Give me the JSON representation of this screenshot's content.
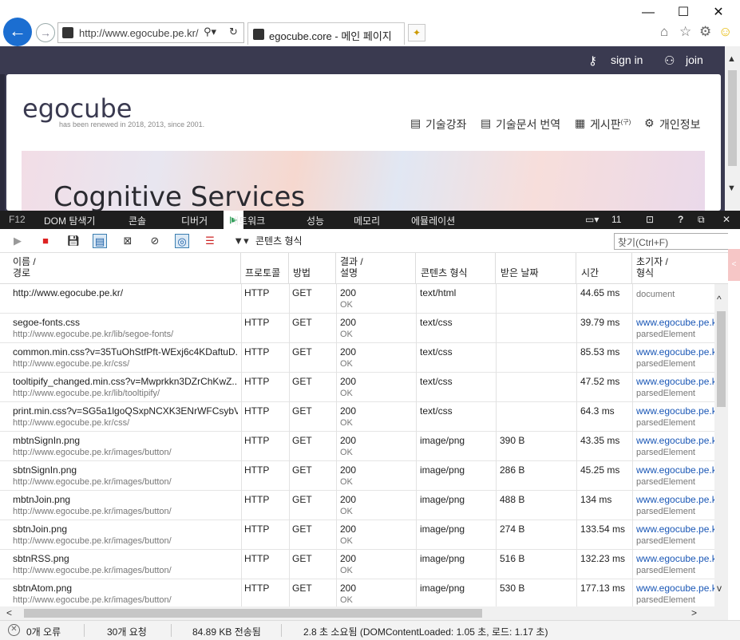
{
  "browser": {
    "window": {
      "min": "—",
      "max": "☐",
      "close": "✕"
    },
    "address": {
      "url": "http://www.egocube.pe.kr/",
      "search_icon": "⚲▾",
      "refresh_icon": "↻"
    },
    "tab": {
      "title": "egocube.core - 메인 페이지",
      "close": "✕"
    },
    "icons": {
      "home": "⌂",
      "favorites": "☆",
      "settings": "⚙",
      "smiley": "☺"
    }
  },
  "site": {
    "signin": "sign in",
    "join": "join",
    "logo": "egocube",
    "tagline": "has been renewed in 2018, 2013, since 2001.",
    "menu": [
      "기술강좌",
      "기술문서 번역",
      "게시판",
      "개인정보"
    ],
    "menu_icons": [
      "document-icon",
      "document-icon",
      "board-icon",
      "gear-icon"
    ],
    "board_sup": "(구)",
    "banner_text": "Cognitive Services"
  },
  "devtools": {
    "tabs": [
      "F12",
      "DOM 탐색기",
      "콘솔",
      "디버거",
      "네트워크",
      "성능",
      "메모리",
      "에뮬레이션"
    ],
    "active_tab": "네트워크",
    "emulation_count": "11",
    "toolbar": {
      "filter_label": "콘텐츠 형식",
      "find_placeholder": "찾기(Ctrl+F)"
    },
    "columns": [
      {
        "l1": "이름 /",
        "l2": "경로"
      },
      {
        "l1": "프로토콜",
        "l2": ""
      },
      {
        "l1": "방법",
        "l2": ""
      },
      {
        "l1": "결과 /",
        "l2": "설명"
      },
      {
        "l1": "콘텐츠 형식",
        "l2": ""
      },
      {
        "l1": "받은 날짜",
        "l2": ""
      },
      {
        "l1": "시간",
        "l2": ""
      },
      {
        "l1": "초기자 /",
        "l2": "형식"
      }
    ],
    "rows": [
      {
        "name": "http://www.egocube.pe.kr/",
        "path": "",
        "protocol": "HTTP",
        "method": "GET",
        "result": "200",
        "desc": "OK",
        "type": "text/html",
        "received": "",
        "time": "44.65 ms",
        "initiator": "",
        "init_type": "document"
      },
      {
        "name": "segoe-fonts.css",
        "path": "http://www.egocube.pe.kr/lib/segoe-fonts/",
        "protocol": "HTTP",
        "method": "GET",
        "result": "200",
        "desc": "OK",
        "type": "text/css",
        "received": "",
        "time": "39.79 ms",
        "initiator": "www.egocube.pe.k",
        "init_type": "parsedElement"
      },
      {
        "name": "common.min.css?v=35TuOhStfPft-WExj6c4KDaftuD...",
        "path": "http://www.egocube.pe.kr/css/",
        "protocol": "HTTP",
        "method": "GET",
        "result": "200",
        "desc": "OK",
        "type": "text/css",
        "received": "",
        "time": "85.53 ms",
        "initiator": "www.egocube.pe.k",
        "init_type": "parsedElement"
      },
      {
        "name": "tooltipify_changed.min.css?v=Mwprkkn3DZrChKwZ...",
        "path": "http://www.egocube.pe.kr/lib/tooltipify/",
        "protocol": "HTTP",
        "method": "GET",
        "result": "200",
        "desc": "OK",
        "type": "text/css",
        "received": "",
        "time": "47.52 ms",
        "initiator": "www.egocube.pe.k",
        "init_type": "parsedElement"
      },
      {
        "name": "print.min.css?v=SG5a1lgoQSxpNCXK3ENrWFCsybV...",
        "path": "http://www.egocube.pe.kr/css/",
        "protocol": "HTTP",
        "method": "GET",
        "result": "200",
        "desc": "OK",
        "type": "text/css",
        "received": "",
        "time": "64.3 ms",
        "initiator": "www.egocube.pe.k",
        "init_type": "parsedElement"
      },
      {
        "name": "mbtnSignIn.png",
        "path": "http://www.egocube.pe.kr/images/button/",
        "protocol": "HTTP",
        "method": "GET",
        "result": "200",
        "desc": "OK",
        "type": "image/png",
        "received": "390 B",
        "time": "43.35 ms",
        "initiator": "www.egocube.pe.k",
        "init_type": "parsedElement"
      },
      {
        "name": "sbtnSignIn.png",
        "path": "http://www.egocube.pe.kr/images/button/",
        "protocol": "HTTP",
        "method": "GET",
        "result": "200",
        "desc": "OK",
        "type": "image/png",
        "received": "286 B",
        "time": "45.25 ms",
        "initiator": "www.egocube.pe.k",
        "init_type": "parsedElement"
      },
      {
        "name": "mbtnJoin.png",
        "path": "http://www.egocube.pe.kr/images/button/",
        "protocol": "HTTP",
        "method": "GET",
        "result": "200",
        "desc": "OK",
        "type": "image/png",
        "received": "488 B",
        "time": "134 ms",
        "initiator": "www.egocube.pe.k",
        "init_type": "parsedElement"
      },
      {
        "name": "sbtnJoin.png",
        "path": "http://www.egocube.pe.kr/images/button/",
        "protocol": "HTTP",
        "method": "GET",
        "result": "200",
        "desc": "OK",
        "type": "image/png",
        "received": "274 B",
        "time": "133.54 ms",
        "initiator": "www.egocube.pe.k",
        "init_type": "parsedElement"
      },
      {
        "name": "sbtnRSS.png",
        "path": "http://www.egocube.pe.kr/images/button/",
        "protocol": "HTTP",
        "method": "GET",
        "result": "200",
        "desc": "OK",
        "type": "image/png",
        "received": "516 B",
        "time": "132.23 ms",
        "initiator": "www.egocube.pe.k",
        "init_type": "parsedElement"
      },
      {
        "name": "sbtnAtom.png",
        "path": "http://www.egocube.pe.kr/images/button/",
        "protocol": "HTTP",
        "method": "GET",
        "result": "200",
        "desc": "OK",
        "type": "image/png",
        "received": "530 B",
        "time": "177.13 ms",
        "initiator": "www.egocube.pe.k",
        "init_type": "parsedElement"
      }
    ],
    "status": {
      "errors": "0개 오류",
      "requests": "30개 요청",
      "transferred": "84.89 KB 전송됨",
      "elapsed": "2.8 초 소요됨 (DOMContentLoaded: 1.05 초, 로드: 1.17 초)"
    }
  },
  "colors": {
    "accent": "#1b6ed1",
    "site_header": "#3a3a50",
    "devtools_bar": "#1e1e1e",
    "link": "#1a57b6"
  }
}
